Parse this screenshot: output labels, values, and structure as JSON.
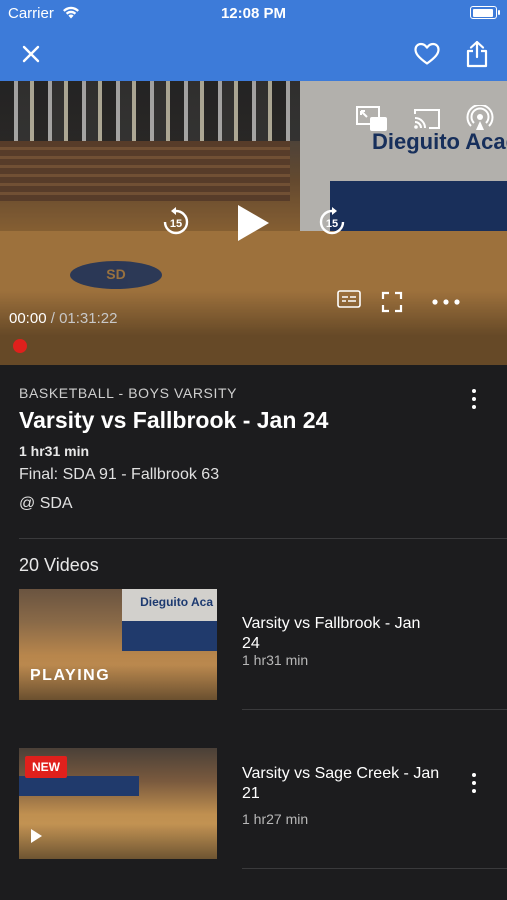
{
  "status_bar": {
    "carrier": "Carrier",
    "time": "12:08 PM"
  },
  "navbar": {
    "background": "#3d7bd9",
    "close_icon": "close-icon",
    "favorite_icon": "heart-outline-icon",
    "share_icon": "share-icon"
  },
  "player": {
    "current_time": "00:00",
    "separator": "/",
    "total_time": "01:31:22",
    "progress": 0,
    "scene_wordmark": "Dieguito Acad",
    "court_logo": "SD",
    "controls": {
      "rewind_seconds": "15",
      "forward_seconds": "15"
    },
    "accent": "#e0201c"
  },
  "details": {
    "category": "BASKETBALL - BOYS VARSITY",
    "title": "Varsity vs Fallbrook - Jan 24",
    "duration": "1 hr31 min",
    "score": "Final: SDA 91 - Fallbrook 63",
    "location": "@ SDA"
  },
  "videos_section": {
    "heading": "20 Videos",
    "items": [
      {
        "title": "Varsity vs Fallbrook - Jan 24",
        "duration": "1 hr31 min",
        "overlay": "PLAYING",
        "thumb_wordmark": "Dieguito Aca"
      },
      {
        "title": "Varsity vs Sage Creek - Jan 21",
        "duration": "1 hr27 min",
        "badge": "NEW"
      }
    ]
  }
}
